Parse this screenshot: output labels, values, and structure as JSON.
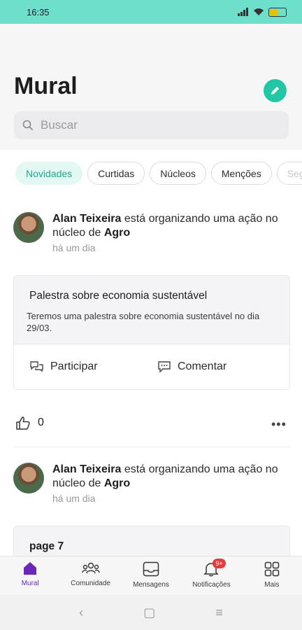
{
  "status": {
    "time": "16:35"
  },
  "header": {
    "title": "Mural"
  },
  "search": {
    "placeholder": "Buscar"
  },
  "chips": [
    "Novidades",
    "Curtidas",
    "Núcleos",
    "Menções",
    "Seg"
  ],
  "posts": [
    {
      "author": "Alan Teixeira",
      "action": "está organizando uma ação no núcleo de",
      "group": "Agro",
      "time": "há um dia",
      "card_title": "Palestra sobre economia sustentável",
      "card_desc": "Teremos uma palestra sobre economia sustentável no dia 29/03.",
      "participate_label": "Participar",
      "comment_label": "Comentar",
      "likes": "0"
    },
    {
      "author": "Alan Teixeira",
      "action": "está organizando uma ação no núcleo de",
      "group": "Agro",
      "time": "há um dia",
      "card_title": "page 7"
    }
  ],
  "tabs": [
    {
      "label": "Mural",
      "icon": "home-icon"
    },
    {
      "label": "Comunidade",
      "icon": "community-icon"
    },
    {
      "label": "Mensagens",
      "icon": "inbox-icon"
    },
    {
      "label": "Notificações",
      "icon": "bell-icon",
      "badge": "9+"
    },
    {
      "label": "Mais",
      "icon": "grid-icon"
    }
  ],
  "colors": {
    "statusbar": "#6ddfca",
    "accent": "#21c6a4",
    "active_tab": "#6a27b8",
    "badge": "#e63b3b"
  }
}
